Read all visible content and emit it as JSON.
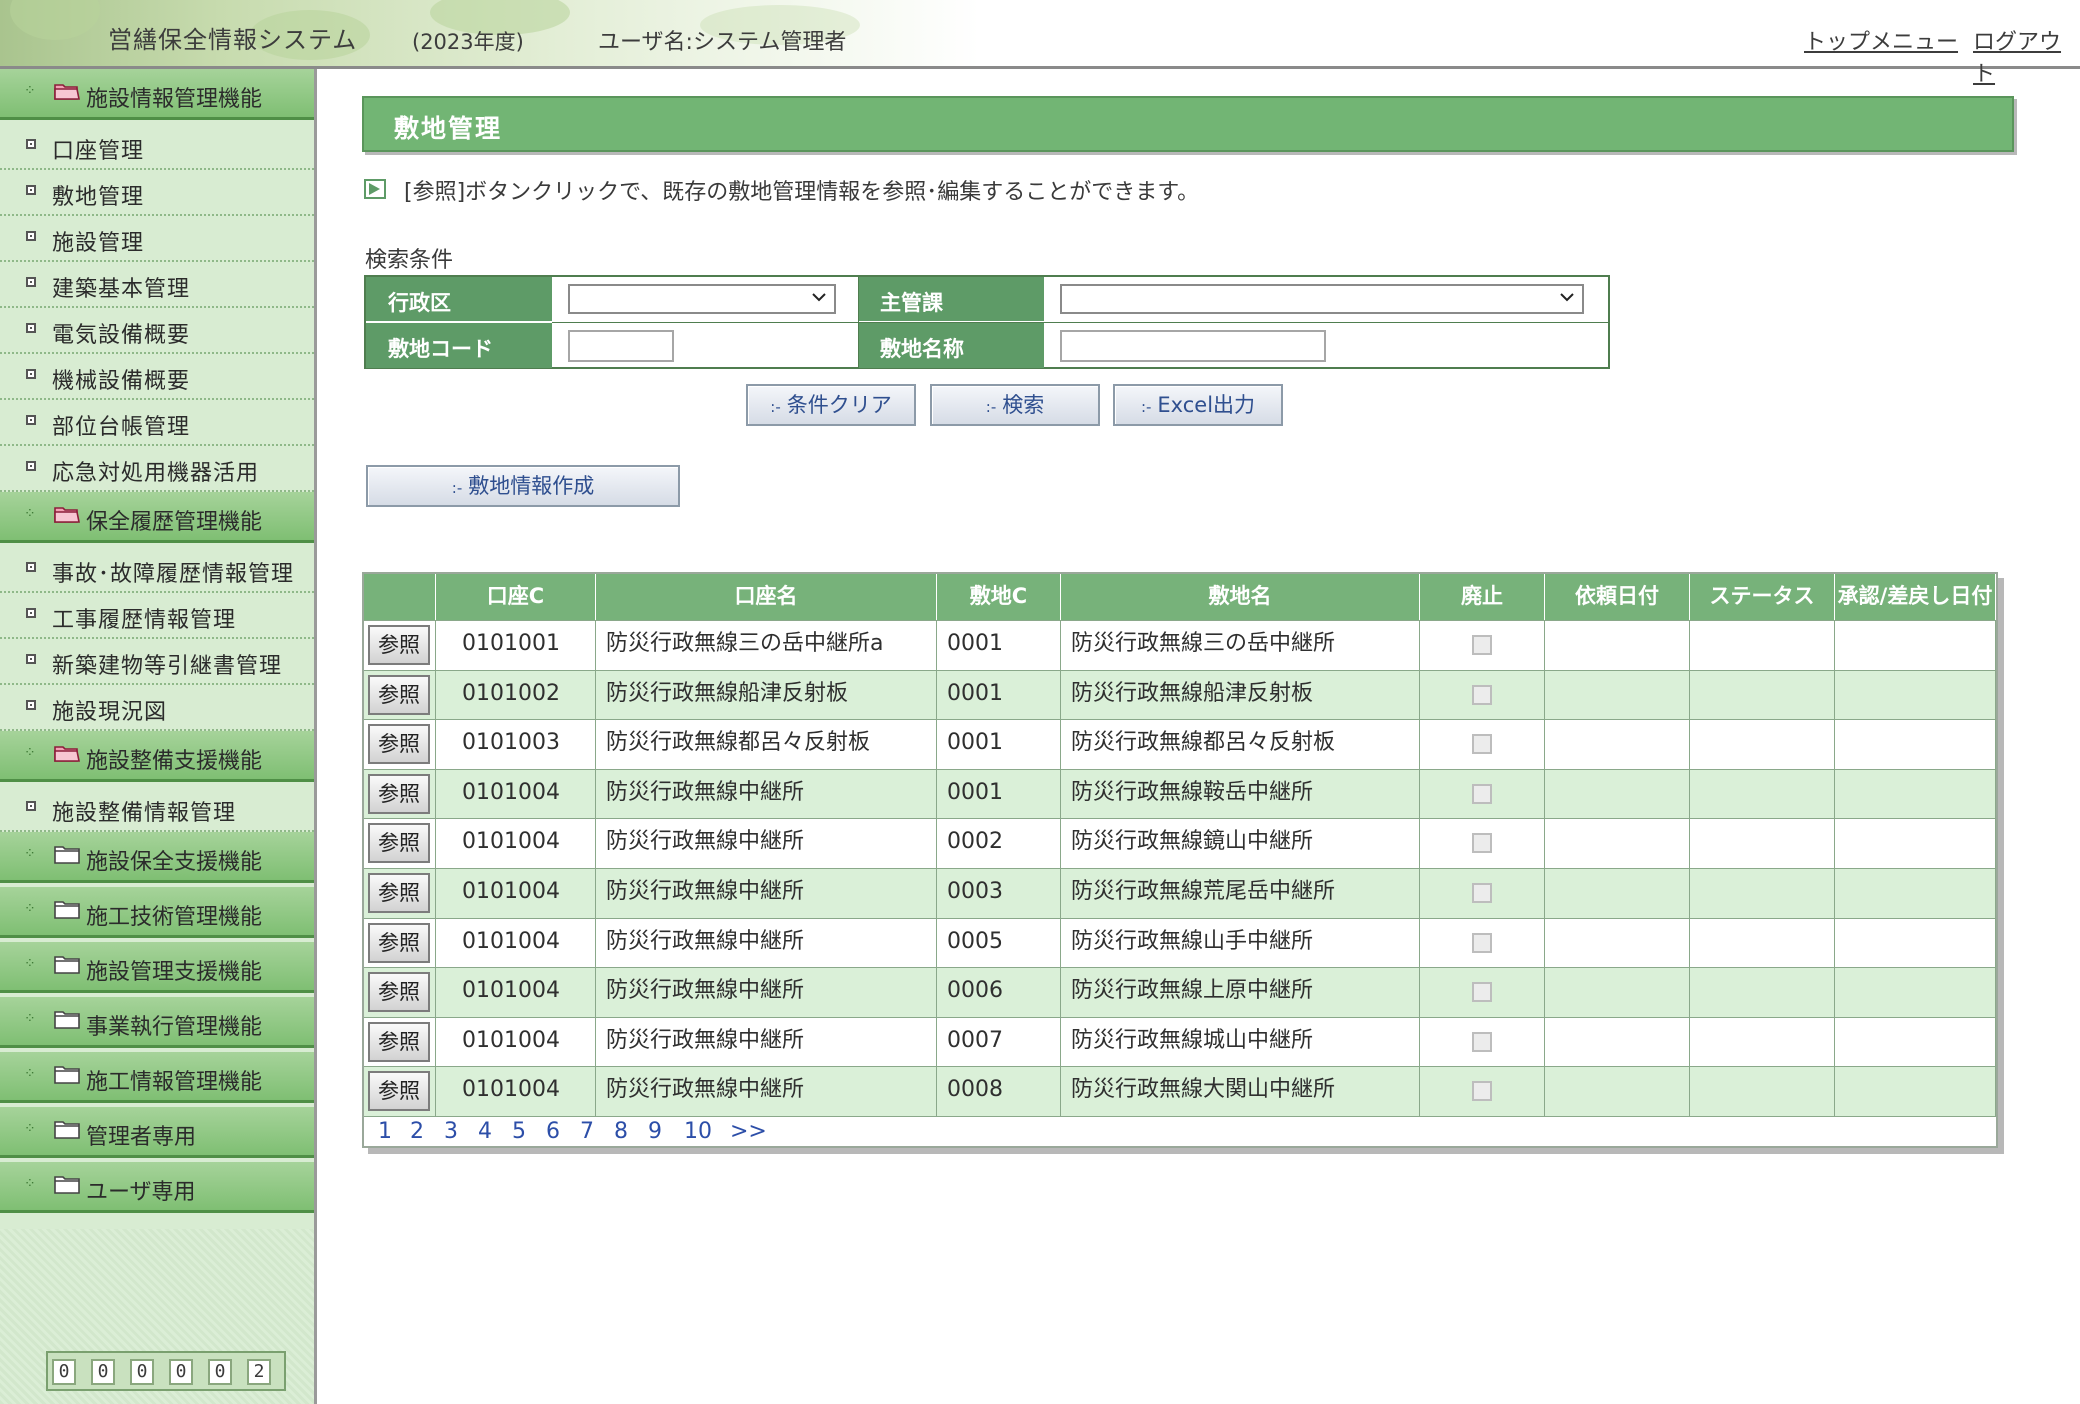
{
  "header": {
    "system_title": "営繕保全情報システム",
    "fiscal_year": "(2023年度)",
    "user_label": "ユーザ名:システム管理者",
    "top_menu": "トップメニュー",
    "logout": "ログアウト"
  },
  "sidebar": {
    "sections": [
      {
        "label": "施設情報管理機能",
        "open": true,
        "items": [
          "口座管理",
          "敷地管理",
          "施設管理",
          "建築基本管理",
          "電気設備概要",
          "機械設備概要",
          "部位台帳管理",
          "応急対処用機器活用"
        ]
      },
      {
        "label": "保全履歴管理機能",
        "open": true,
        "items": [
          "事故･故障履歴情報管理",
          "工事履歴情報管理",
          "新築建物等引継書管理",
          "施設現況図"
        ]
      },
      {
        "label": "施設整備支援機能",
        "open": true,
        "items": [
          "施設整備情報管理"
        ]
      },
      {
        "label": "施設保全支援機能",
        "open": false,
        "items": []
      },
      {
        "label": "施工技術管理機能",
        "open": false,
        "items": []
      },
      {
        "label": "施設管理支援機能",
        "open": false,
        "items": []
      },
      {
        "label": "事業執行管理機能",
        "open": false,
        "items": []
      },
      {
        "label": "施工情報管理機能",
        "open": false,
        "items": []
      },
      {
        "label": "管理者専用",
        "open": false,
        "items": []
      },
      {
        "label": "ユーザ専用",
        "open": false,
        "items": []
      }
    ],
    "counter": [
      "0",
      "0",
      "0",
      "0",
      "0",
      "2"
    ]
  },
  "main": {
    "page_title": "敷地管理",
    "instruction": "[参照]ボタンクリックで、既存の敷地管理情報を参照･編集することができます。",
    "search": {
      "caption": "検索条件",
      "ward_label": "行政区",
      "ward_value": "",
      "dept_label": "主管課",
      "dept_value": "",
      "site_code_label": "敷地コード",
      "site_code_value": "",
      "site_name_label": "敷地名称",
      "site_name_value": ""
    },
    "buttons": {
      "clear": "条件クリア",
      "search": "検索",
      "excel": "Excel出力",
      "create": "敷地情報作成",
      "prefix": ":-"
    },
    "grid": {
      "ref_label": "参照",
      "columns": [
        "口座C",
        "口座名",
        "敷地C",
        "敷地名",
        "廃止",
        "依頼日付",
        "ステータス",
        "承認/差戻し日付"
      ],
      "rows": [
        {
          "account_code": "0101001",
          "account_name": "防災行政無線三の岳中継所a",
          "site_code": "0001",
          "site_name": "防災行政無線三の岳中継所",
          "abolished": false,
          "request_date": "",
          "status": "",
          "approval_date": ""
        },
        {
          "account_code": "0101002",
          "account_name": "防災行政無線船津反射板",
          "site_code": "0001",
          "site_name": "防災行政無線船津反射板",
          "abolished": false,
          "request_date": "",
          "status": "",
          "approval_date": ""
        },
        {
          "account_code": "0101003",
          "account_name": "防災行政無線都呂々反射板",
          "site_code": "0001",
          "site_name": "防災行政無線都呂々反射板",
          "abolished": false,
          "request_date": "",
          "status": "",
          "approval_date": ""
        },
        {
          "account_code": "0101004",
          "account_name": "防災行政無線中継所",
          "site_code": "0001",
          "site_name": "防災行政無線鞍岳中継所",
          "abolished": false,
          "request_date": "",
          "status": "",
          "approval_date": ""
        },
        {
          "account_code": "0101004",
          "account_name": "防災行政無線中継所",
          "site_code": "0002",
          "site_name": "防災行政無線鏡山中継所",
          "abolished": false,
          "request_date": "",
          "status": "",
          "approval_date": ""
        },
        {
          "account_code": "0101004",
          "account_name": "防災行政無線中継所",
          "site_code": "0003",
          "site_name": "防災行政無線荒尾岳中継所",
          "abolished": false,
          "request_date": "",
          "status": "",
          "approval_date": ""
        },
        {
          "account_code": "0101004",
          "account_name": "防災行政無線中継所",
          "site_code": "0005",
          "site_name": "防災行政無線山手中継所",
          "abolished": false,
          "request_date": "",
          "status": "",
          "approval_date": ""
        },
        {
          "account_code": "0101004",
          "account_name": "防災行政無線中継所",
          "site_code": "0006",
          "site_name": "防災行政無線上原中継所",
          "abolished": false,
          "request_date": "",
          "status": "",
          "approval_date": ""
        },
        {
          "account_code": "0101004",
          "account_name": "防災行政無線中継所",
          "site_code": "0007",
          "site_name": "防災行政無線城山中継所",
          "abolished": false,
          "request_date": "",
          "status": "",
          "approval_date": ""
        },
        {
          "account_code": "0101004",
          "account_name": "防災行政無線中継所",
          "site_code": "0008",
          "site_name": "防災行政無線大関山中継所",
          "abolished": false,
          "request_date": "",
          "status": "",
          "approval_date": ""
        }
      ],
      "pages": [
        "1",
        "2",
        "3",
        "4",
        "5",
        "6",
        "7",
        "8",
        "9",
        "10",
        ">>"
      ]
    }
  },
  "colors": {
    "menu_green": "#7fbf73",
    "title_bar": "#72b574",
    "row_alt": "#daf0d8",
    "link_blue": "#2c4ea8"
  }
}
